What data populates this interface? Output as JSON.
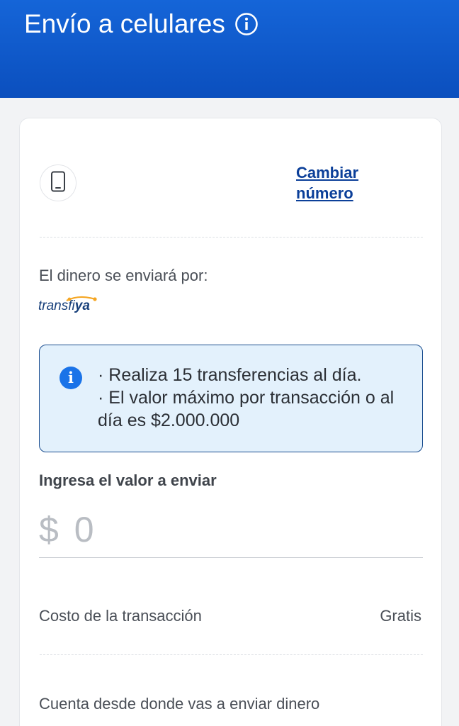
{
  "header": {
    "title": "Envío a celulares",
    "info_icon": "info-circle-icon",
    "color": "#1565d8"
  },
  "recipient": {
    "phone_icon": "smartphone-icon",
    "change_label": "Cambiar número"
  },
  "delivery": {
    "label": "El dinero se enviará por:",
    "brand_normal": "transfi",
    "brand_bold": "ya"
  },
  "notice": {
    "icon": "info-icon",
    "line1": "· Realiza 15 transferencias al día.",
    "line2": "· El valor máximo por transacción o al día es $2.000.000"
  },
  "amount": {
    "label": "Ingresa el valor a enviar",
    "value": "$ 0"
  },
  "cost": {
    "label": "Costo de la transacción",
    "value": "Gratis"
  },
  "account": {
    "label": "Cuenta desde donde vas a enviar dinero"
  }
}
